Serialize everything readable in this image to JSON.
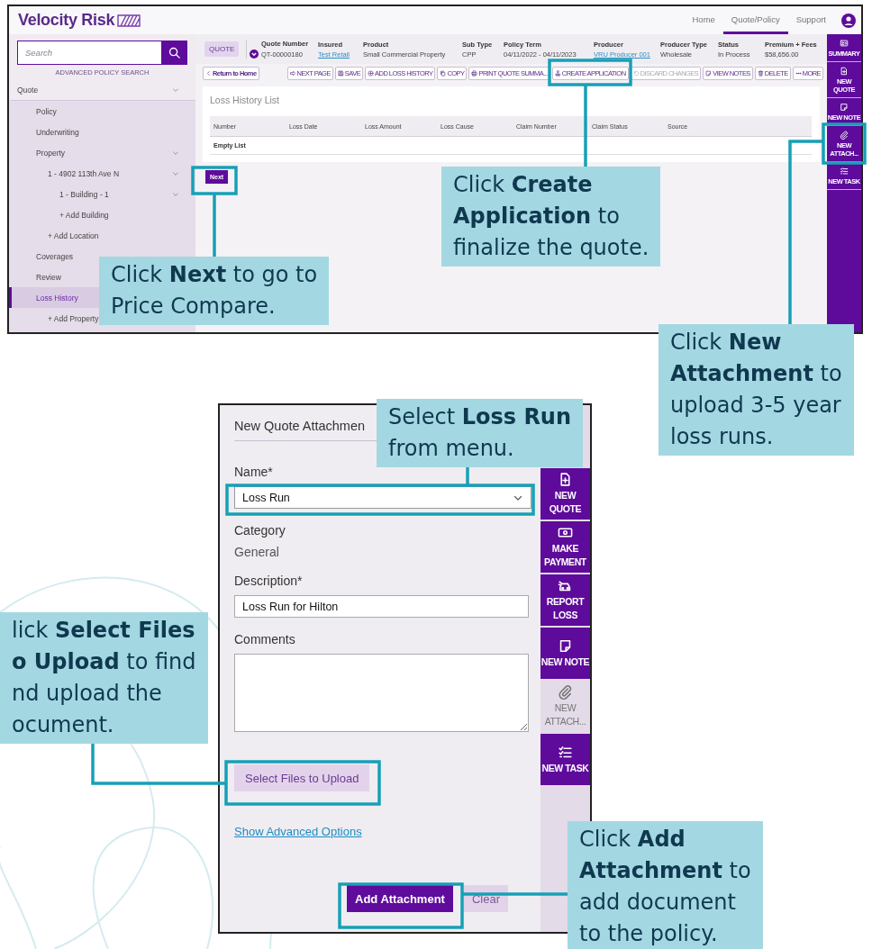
{
  "header": {
    "logo": "Velocity Risk",
    "nav": [
      {
        "label": "Home",
        "selected": false
      },
      {
        "label": "Quote/Policy",
        "selected": true
      },
      {
        "label": "Support",
        "selected": false
      }
    ]
  },
  "sidebar": {
    "search": {
      "placeholder": "Search"
    },
    "advanced_search": "ADVANCED POLICY SEARCH",
    "tree": [
      {
        "label": "Quote",
        "expanded": true,
        "selected": false,
        "children": [
          {
            "label": "Policy",
            "selected": false
          },
          {
            "label": "Underwriting",
            "selected": false
          },
          {
            "label": "Property",
            "expanded": true,
            "selected": false,
            "children": [
              {
                "label": "1 - 4902 113th Ave N",
                "expanded": true,
                "selected": false,
                "children": [
                  {
                    "label": "1 - Building - 1",
                    "expanded": true,
                    "selected": false
                  },
                  {
                    "label": "+ Add Building",
                    "selected": false
                  }
                ]
              },
              {
                "label": "+ Add Location",
                "selected": false
              }
            ]
          },
          {
            "label": "Coverages",
            "selected": false
          },
          {
            "label": "Review",
            "selected": false
          },
          {
            "label": "Loss History",
            "selected": true,
            "children": [
              {
                "label": "+ Add Property",
                "selected": false
              }
            ]
          }
        ]
      }
    ]
  },
  "quote_bar": {
    "badge": "QUOTE",
    "fields": [
      {
        "label": "Quote Number",
        "value": "QT-00000180",
        "kind": "menu"
      },
      {
        "label": "Insured",
        "value": "Test Retail",
        "kind": "link"
      },
      {
        "label": "Product",
        "value": "Small Commercial Property",
        "kind": "text"
      },
      {
        "label": "Sub Type",
        "value": "CPP",
        "kind": "text"
      },
      {
        "label": "Policy Term",
        "value": "04/11/2022 - 04/11/2023",
        "kind": "text"
      },
      {
        "label": "Producer",
        "value": "VRU Producer 001",
        "kind": "link"
      },
      {
        "label": "Producer Type",
        "value": "Wholesale",
        "kind": "text"
      },
      {
        "label": "Status",
        "value": "In Process",
        "kind": "text"
      },
      {
        "label": "Premium + Fees",
        "value": "$58,656.00",
        "kind": "text"
      }
    ]
  },
  "toolbar": {
    "back": "Return to Home",
    "buttons": [
      {
        "label": "NEXT PAGE",
        "disabled": false
      },
      {
        "label": "SAVE",
        "disabled": false
      },
      {
        "label": "ADD LOSS HISTORY",
        "disabled": false
      },
      {
        "label": "COPY",
        "disabled": false
      },
      {
        "label": "PRINT QUOTE SUMMA...",
        "disabled": false
      },
      {
        "label": "CREATE APPLICATION",
        "disabled": false
      },
      {
        "label": "DISCARD CHANGES",
        "disabled": true
      },
      {
        "label": "VIEW NOTES",
        "disabled": false
      },
      {
        "label": "DELETE",
        "disabled": false
      },
      {
        "label": "MORE",
        "disabled": false
      }
    ]
  },
  "loss_history": {
    "title": "Loss History List",
    "columns": [
      "Number",
      "Loss Date",
      "Loss Amount",
      "Loss Cause",
      "Claim Number",
      "Claim Status",
      "Source"
    ],
    "empty": "Empty List"
  },
  "next_button": "Next",
  "side_rail": [
    {
      "label": "SUMMARY"
    },
    {
      "label": "NEW QUOTE"
    },
    {
      "label": "NEW NOTE"
    },
    {
      "label": "NEW ATTACH..."
    },
    {
      "label": "NEW TASK"
    }
  ],
  "dialog": {
    "title": "New Quote Attachmen",
    "fields": [
      {
        "kind": "select",
        "label": "Name*",
        "value": "Loss Run"
      },
      {
        "kind": "static",
        "label": "Category",
        "value": "General"
      },
      {
        "kind": "input",
        "label": "Description*",
        "value": "Loss Run for Hilton"
      },
      {
        "kind": "textarea",
        "label": "Comments"
      }
    ],
    "upload_button": "Select Files to Upload",
    "advanced_link": "Show Advanced Options",
    "actions": [
      {
        "label": "Add Attachment",
        "kind": "primary"
      },
      {
        "label": "Clear",
        "kind": "secondary"
      }
    ],
    "rail": [
      {
        "label": "NEW QUOTE",
        "selected": false
      },
      {
        "label": "MAKE PAYMENT",
        "selected": false
      },
      {
        "label": "REPORT LOSS",
        "selected": false
      },
      {
        "label": "NEW NOTE",
        "selected": false
      },
      {
        "label": "NEW ATTACH...",
        "selected": true
      },
      {
        "label": "NEW TASK",
        "selected": false
      }
    ]
  },
  "callouts": [
    {
      "lines": [
        "Click **Create**",
        "**Application** to",
        "finalize the quote."
      ]
    },
    {
      "lines": [
        "Click **Next** to go to",
        "Price Compare."
      ]
    },
    {
      "lines": [
        "Click **New**",
        "**Attachment** to",
        "upload 3-5 year",
        "loss runs."
      ]
    },
    {
      "lines": [
        "Select **Loss Run**",
        "from menu."
      ]
    },
    {
      "lines": [
        "lick **Select Files**",
        "**o Upload** to find",
        "nd upload the",
        "ocument."
      ]
    },
    {
      "lines": [
        "Click **Add**",
        "**Attachment** to",
        "add document",
        "to the policy."
      ]
    }
  ]
}
